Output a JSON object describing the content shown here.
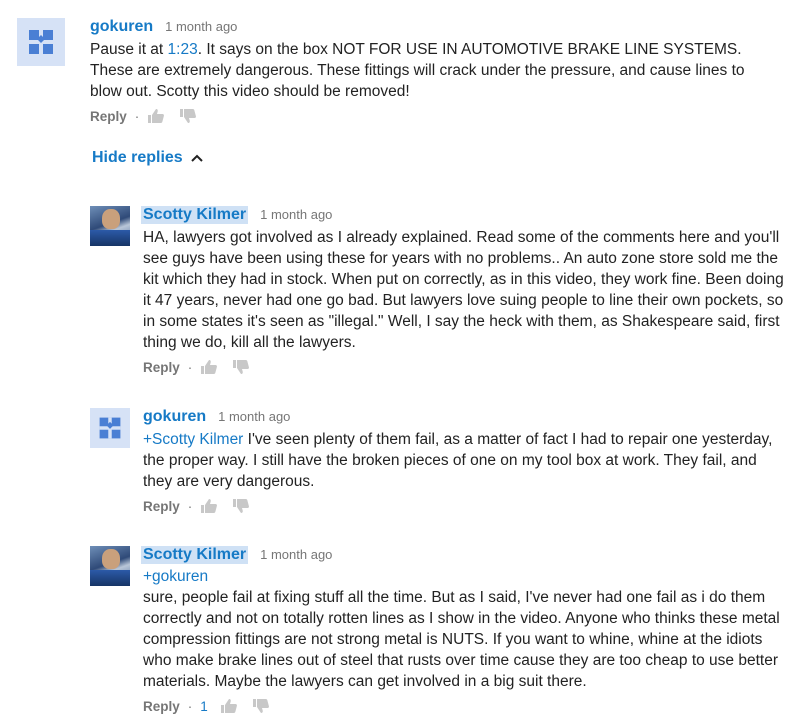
{
  "comments": [
    {
      "author": "gokuren",
      "time": "1 month ago",
      "text_before": "Pause it at ",
      "timestamp_link": "1:23",
      "text_after": ". It says on the box NOT FOR USE IN AUTOMOTIVE BRAKE LINE SYSTEMS. These are extremely dangerous. These fittings will crack under the pressure, and cause lines to blow out. Scotty this video should be removed!",
      "reply_label": "Reply",
      "dot": "·"
    },
    {
      "author": "Scotty Kilmer",
      "time": "1 month ago",
      "text": "HA, lawyers got involved as I already explained. Read some of the comments here and you'll see guys have been using these for years with no problems.. An auto zone store sold me the kit which they had in stock. When put on correctly, as in this video, they work fine. Been doing it 47 years, never had one go bad. But lawyers love suing people to line their own pockets, so in some states it's seen as \"illegal.\"  Well, I say the heck with them, as Shakespeare said, first thing we do, kill all the lawyers.",
      "reply_label": "Reply",
      "dot": "·"
    },
    {
      "author": "gokuren",
      "time": "1 month ago",
      "mention": "+Scotty Kilmer",
      "text": " I've seen plenty of them fail, as a matter of fact I had to repair one yesterday, the proper way. I still have the broken pieces of one on my tool box at work. They fail, and they are very dangerous.",
      "reply_label": "Reply",
      "dot": "·"
    },
    {
      "author": "Scotty Kilmer",
      "time": "1 month ago",
      "mention": "+gokuren",
      "text": "sure, people fail at fixing stuff all the time. But as I said, I've never had one fail as i do them correctly and not on totally rotten lines as I show in the video. Anyone who thinks these metal compression fittings are not strong metal is NUTS. If you want to whine, whine at the idiots who make brake lines out of steel that rusts over time cause they are too cheap to use better materials. Maybe the lawyers can get involved in a big suit there.",
      "reply_label": "Reply",
      "dot": "·",
      "like_count": "1"
    }
  ],
  "hide_replies": {
    "label": "Hide replies",
    "icon": "chevron-up-icon"
  },
  "colors": {
    "link": "#167ac6",
    "meta": "#767676",
    "author_highlight": "#cfe1f5"
  }
}
